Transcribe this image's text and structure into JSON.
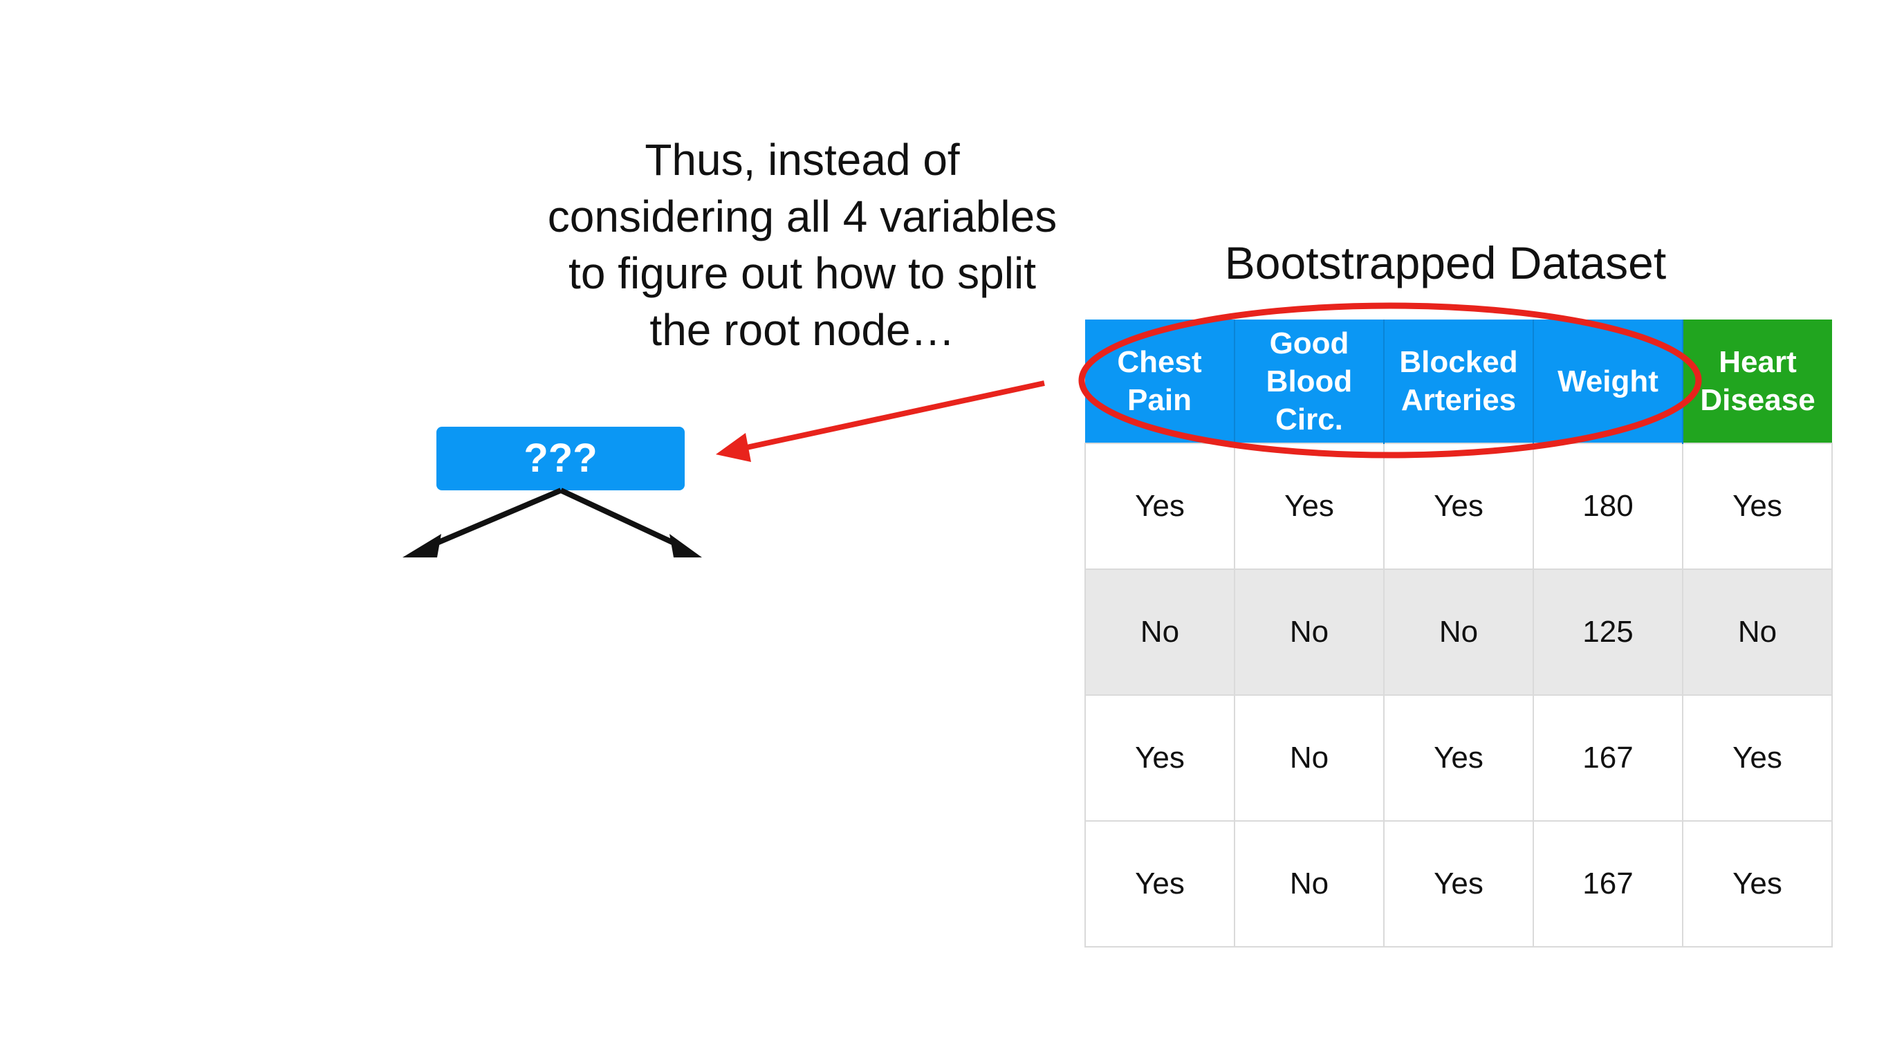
{
  "caption_lines": [
    "Thus, instead of",
    "considering all 4 variables",
    "to figure out how to split",
    "the root node…"
  ],
  "root_node_label": "???",
  "dataset_title": "Bootstrapped Dataset",
  "table": {
    "headers": [
      "Chest Pain",
      "Good Blood Circ.",
      "Blocked Arteries",
      "Weight",
      "Heart Disease"
    ],
    "rows": [
      [
        "Yes",
        "Yes",
        "Yes",
        "180",
        "Yes"
      ],
      [
        "No",
        "No",
        "No",
        "125",
        "No"
      ],
      [
        "Yes",
        "No",
        "Yes",
        "167",
        "Yes"
      ],
      [
        "Yes",
        "No",
        "Yes",
        "167",
        "Yes"
      ]
    ]
  },
  "colors": {
    "feature_header": "#0b97f4",
    "target_header": "#21a51f",
    "highlight_ellipse": "#e8231c",
    "pointer_arrow": "#e8231c",
    "branch_arrows": "#111111",
    "shaded_row": "#e8e8e8"
  }
}
